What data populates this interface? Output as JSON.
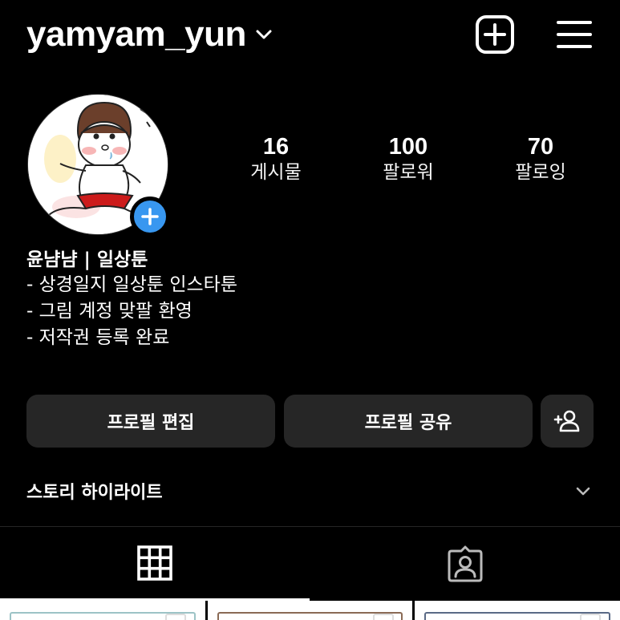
{
  "header": {
    "username": "yamyam_yun",
    "dropdown_icon": "chevron-down-icon",
    "add_icon": "plus-square-icon",
    "menu_icon": "hamburger-menu-icon"
  },
  "profile": {
    "avatar_icon": "avatar-illustration",
    "add_story_icon": "plus-icon",
    "stats": {
      "posts": {
        "value": "16",
        "label": "게시물"
      },
      "followers": {
        "value": "100",
        "label": "팔로워"
      },
      "following": {
        "value": "70",
        "label": "팔로잉"
      }
    }
  },
  "bio": {
    "name": "윤냠냠 | 일상툰",
    "lines": [
      "- 상경일지 일상툰 인스타툰",
      "- 그림 계정 맞팔 환영",
      "- 저작권 등록 완료"
    ]
  },
  "actions": {
    "edit_label": "프로필 편집",
    "share_label": "프로필 공유",
    "discover_icon": "add-person-icon"
  },
  "highlights": {
    "label": "스토리 하이라이트",
    "icon": "chevron-down-icon"
  },
  "tabs": [
    {
      "name": "grid",
      "icon": "grid-icon",
      "active": true
    },
    {
      "name": "tagged",
      "icon": "tagged-person-icon",
      "active": false
    }
  ],
  "colors": {
    "background": "#000000",
    "button": "#262626",
    "accent": "#3897f0"
  }
}
